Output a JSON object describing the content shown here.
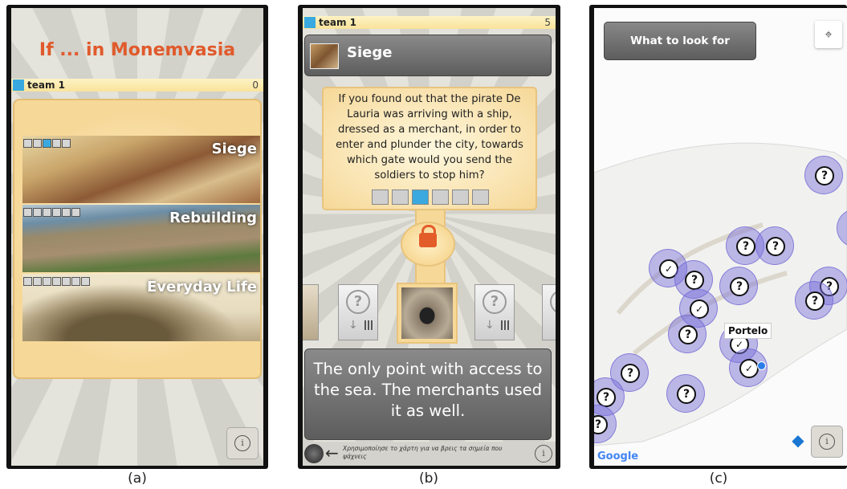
{
  "captions": [
    "(a)",
    "(b)",
    "(c)"
  ],
  "screen_a": {
    "title": "If ... in Monemvasia",
    "team": {
      "name": "team 1",
      "score": "0",
      "color": "#3aa9df"
    },
    "cards": [
      {
        "label": "Siege",
        "progress_total": 5,
        "progress_active": 3
      },
      {
        "label": "Rebuilding",
        "progress_total": 6,
        "progress_active": 0
      },
      {
        "label": "Everyday Life",
        "progress_total": 7,
        "progress_active": 0
      }
    ],
    "info_icon": "info-icon"
  },
  "screen_b": {
    "team": {
      "name": "team 1",
      "score": "5"
    },
    "header_title": "Siege",
    "question": "If you found out that the pirate De Lauria was arriving with a ship, dressed as a merchant, in order to enter and plunder the city, towards which gate would you send the soldiers to stop him?",
    "question_steps_total": 6,
    "question_step_active": 3,
    "answer_text": "The only point with access to the sea. The merchants used it as well.",
    "footer_hint": "Χρησιμοποίησε το χάρτη για να βρεις τα σημεία που ψάχνεις",
    "lock_icon": "lock-icon",
    "accent_color": "#e35d2a"
  },
  "screen_c": {
    "look_button": "What to look for",
    "tooltip": "Portelo",
    "map_attribution": "Google",
    "poi_color": "#7a6edc"
  }
}
